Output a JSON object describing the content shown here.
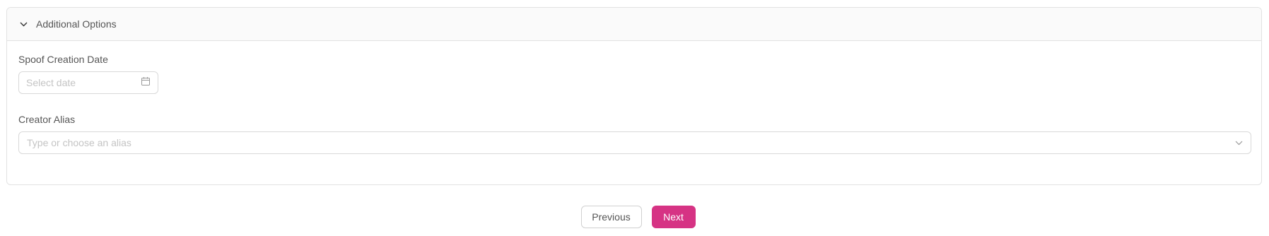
{
  "panel": {
    "title": "Additional Options"
  },
  "fields": {
    "spoof_date": {
      "label": "Spoof Creation Date",
      "placeholder": "Select date"
    },
    "creator_alias": {
      "label": "Creator Alias",
      "placeholder": "Type or choose an alias"
    }
  },
  "actions": {
    "previous_label": "Previous",
    "next_label": "Next"
  },
  "colors": {
    "primary": "#d63384",
    "border": "#e2e2e2",
    "header_bg": "#fafafa"
  },
  "icons": {
    "collapse": "chevron-down-icon",
    "date": "calendar-icon",
    "dropdown": "chevron-down-icon"
  }
}
